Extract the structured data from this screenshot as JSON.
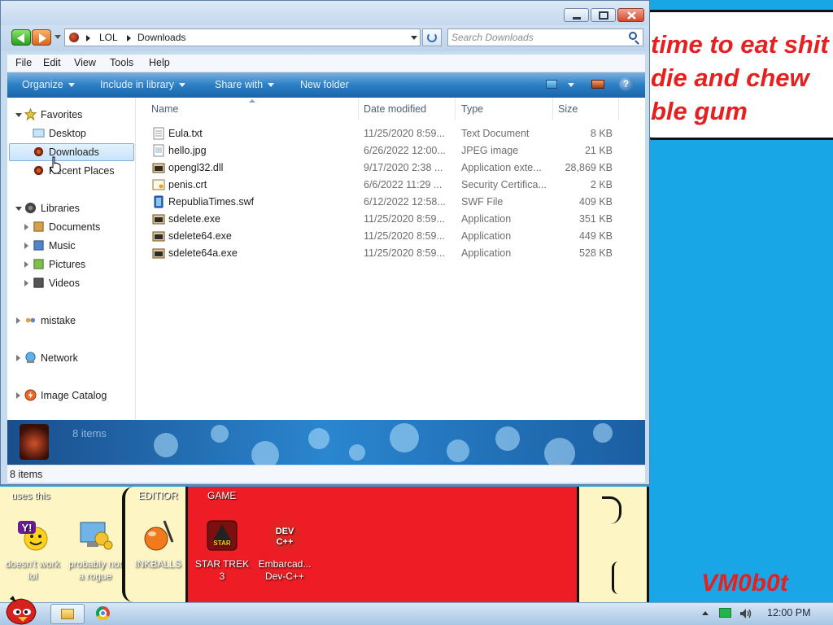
{
  "wallpaper": {
    "bubble_text": "time to eat shit\ndie and chew\nble gum",
    "label_left": "uses this",
    "label_mid": "EDITIOR",
    "label_game": "GAME",
    "signature": "VM0b0t"
  },
  "desktop_icons": [
    {
      "name": "yahoo-messenger-icon",
      "label": "doesn't work lol"
    },
    {
      "name": "settings-monitor-icon",
      "label": "probably not a rogue"
    },
    {
      "name": "inkball-icon",
      "label": "INKBALLS"
    },
    {
      "name": "star-trek-icon",
      "label": "STAR TREK 3"
    },
    {
      "name": "dev-cpp-icon",
      "label": "Embarcad... Dev-C++"
    }
  ],
  "explorer": {
    "address": {
      "crumb1": "LOL",
      "crumb2": "Downloads"
    },
    "search": {
      "placeholder": "Search Downloads"
    },
    "menu": [
      "File",
      "Edit",
      "View",
      "Tools",
      "Help"
    ],
    "commands": [
      "Organize",
      "Include in library",
      "Share with",
      "New folder"
    ],
    "nav": {
      "favorites": "Favorites",
      "desktop": "Desktop",
      "downloads": "Downloads",
      "recent": "Recent Places",
      "libraries": "Libraries",
      "documents": "Documents",
      "music": "Music",
      "pictures": "Pictures",
      "videos": "Videos",
      "mistake": "mistake",
      "network": "Network",
      "image_catalog": "Image Catalog"
    },
    "columns": {
      "name": "Name",
      "date": "Date modified",
      "type": "Type",
      "size": "Size"
    },
    "files": [
      {
        "name": "Eula.txt",
        "date": "11/25/2020 8:59...",
        "type": "Text Document",
        "size": "8 KB",
        "icon": "text-file-icon"
      },
      {
        "name": "hello.jpg",
        "date": "6/26/2022 12:00...",
        "type": "JPEG image",
        "size": "21 KB",
        "icon": "image-file-icon"
      },
      {
        "name": "opengl32.dll",
        "date": "9/17/2020 2:38 ...",
        "type": "Application exte...",
        "size": "28,869 KB",
        "icon": "dll-file-icon"
      },
      {
        "name": "penis.crt",
        "date": "6/6/2022 11:29 ...",
        "type": "Security Certifica...",
        "size": "2 KB",
        "icon": "certificate-file-icon"
      },
      {
        "name": "RepubliaTimes.swf",
        "date": "6/12/2022 12:58...",
        "type": "SWF File",
        "size": "409 KB",
        "icon": "swf-file-icon"
      },
      {
        "name": "sdelete.exe",
        "date": "11/25/2020 8:59...",
        "type": "Application",
        "size": "351 KB",
        "icon": "exe-file-icon"
      },
      {
        "name": "sdelete64.exe",
        "date": "11/25/2020 8:59...",
        "type": "Application",
        "size": "449 KB",
        "icon": "exe-file-icon"
      },
      {
        "name": "sdelete64a.exe",
        "date": "11/25/2020 8:59...",
        "type": "Application",
        "size": "528 KB",
        "icon": "exe-file-icon"
      }
    ],
    "details_count": "8 items",
    "status": "8 items"
  },
  "taskbar": {
    "clock": "12:00 PM"
  },
  "colors": {
    "desktop": "#18a6e6",
    "command_bar": "#2b7fc6",
    "bubble_text": "#e62020"
  }
}
